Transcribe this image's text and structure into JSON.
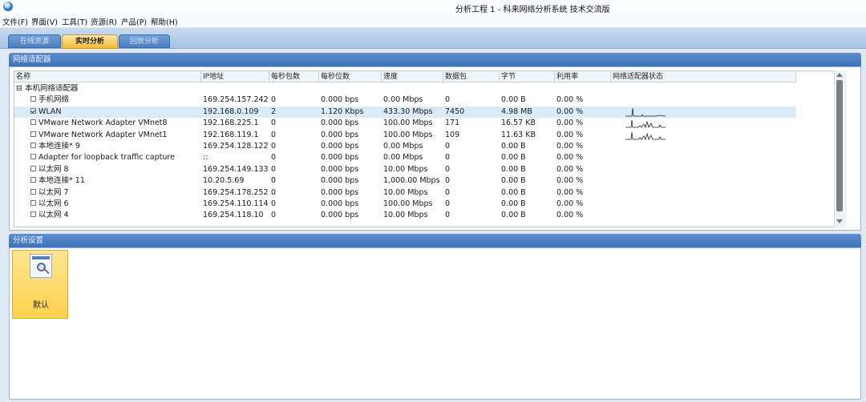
{
  "window": {
    "title": "分析工程 1 - 科来网络分析系统 技术交流版"
  },
  "menu": [
    "文件(F)",
    "界面(V)",
    "工具(T)",
    "资源(R)",
    "产品(P)",
    "帮助(H)"
  ],
  "tabs": [
    {
      "label": "在线资源",
      "active": false
    },
    {
      "label": "实时分析",
      "active": true
    },
    {
      "label": "回放分析",
      "active": false
    }
  ],
  "adapter_panel": {
    "title": "网络适配器",
    "columns": [
      "名称",
      "IP地址",
      "每秒包数",
      "每秒位数",
      "速度",
      "数据包",
      "字节",
      "利用率",
      "网络适配器状态"
    ],
    "group_label": "本机网络适配器",
    "rows": [
      {
        "name": "手机网络",
        "ip": "169.254.157.242",
        "pps": "0",
        "bps": "0.000 bps",
        "speed": "0.00 Mbps",
        "packets": "0",
        "bytes": "0.00 B",
        "util": "0.00 %",
        "checked": false,
        "selected": false,
        "sparkline": ""
      },
      {
        "name": "WLAN",
        "ip": "192.168.0.109",
        "pps": "2",
        "bps": "1.120 Kbps",
        "speed": "433.30 Mbps",
        "packets": "7450",
        "bytes": "4.98 MB",
        "util": "0.00 %",
        "checked": true,
        "selected": true,
        "sparkline": "wlan"
      },
      {
        "name": "VMware Network Adapter VMnet8",
        "ip": "192.168.225.1",
        "pps": "0",
        "bps": "0.000 bps",
        "speed": "100.00 Mbps",
        "packets": "171",
        "bytes": "16.57 KB",
        "util": "0.00 %",
        "checked": false,
        "selected": false,
        "sparkline": "vmnet"
      },
      {
        "name": "VMware Network Adapter VMnet1",
        "ip": "192.168.119.1",
        "pps": "0",
        "bps": "0.000 bps",
        "speed": "100.00 Mbps",
        "packets": "109",
        "bytes": "11.63 KB",
        "util": "0.00 %",
        "checked": false,
        "selected": false,
        "sparkline": "vmnet"
      },
      {
        "name": "本地连接* 9",
        "ip": "169.254.128.122",
        "pps": "0",
        "bps": "0.000 bps",
        "speed": "0.00 Mbps",
        "packets": "0",
        "bytes": "0.00 B",
        "util": "0.00 %",
        "checked": false,
        "selected": false,
        "sparkline": ""
      },
      {
        "name": "Adapter for loopback traffic capture",
        "ip": "::",
        "pps": "0",
        "bps": "0.000 bps",
        "speed": "0.00 Mbps",
        "packets": "0",
        "bytes": "0.00 B",
        "util": "0.00 %",
        "checked": false,
        "selected": false,
        "sparkline": ""
      },
      {
        "name": "以太网 8",
        "ip": "169.254.149.133",
        "pps": "0",
        "bps": "0.000 bps",
        "speed": "10.00 Mbps",
        "packets": "0",
        "bytes": "0.00 B",
        "util": "0.00 %",
        "checked": false,
        "selected": false,
        "sparkline": ""
      },
      {
        "name": "本地连接* 11",
        "ip": "10.20.5.69",
        "pps": "0",
        "bps": "0.000 bps",
        "speed": "1,000.00 Mbps",
        "packets": "0",
        "bytes": "0.00 B",
        "util": "0.00 %",
        "checked": false,
        "selected": false,
        "sparkline": ""
      },
      {
        "name": "以太网 7",
        "ip": "169.254.178.252",
        "pps": "0",
        "bps": "0.000 bps",
        "speed": "10.00 Mbps",
        "packets": "0",
        "bytes": "0.00 B",
        "util": "0.00 %",
        "checked": false,
        "selected": false,
        "sparkline": ""
      },
      {
        "name": "以太网 6",
        "ip": "169.254.110.114",
        "pps": "0",
        "bps": "0.000 bps",
        "speed": "100.00 Mbps",
        "packets": "0",
        "bytes": "0.00 B",
        "util": "0.00 %",
        "checked": false,
        "selected": false,
        "sparkline": ""
      },
      {
        "name": "以太网 4",
        "ip": "169.254.118.10",
        "pps": "0",
        "bps": "0.000 bps",
        "speed": "10.00 Mbps",
        "packets": "0",
        "bytes": "0.00 B",
        "util": "0.00 %",
        "checked": false,
        "selected": false,
        "sparkline": ""
      }
    ]
  },
  "settings_panel": {
    "title": "分析设置",
    "profiles": [
      {
        "label": "默认",
        "icon": "analysis-profile-icon"
      }
    ]
  },
  "colors": {
    "panel_header": "#4a7cc0",
    "active_tab": "#f7b937",
    "selected_row": "#dcebf8",
    "profile_card": "#fbd24d"
  }
}
